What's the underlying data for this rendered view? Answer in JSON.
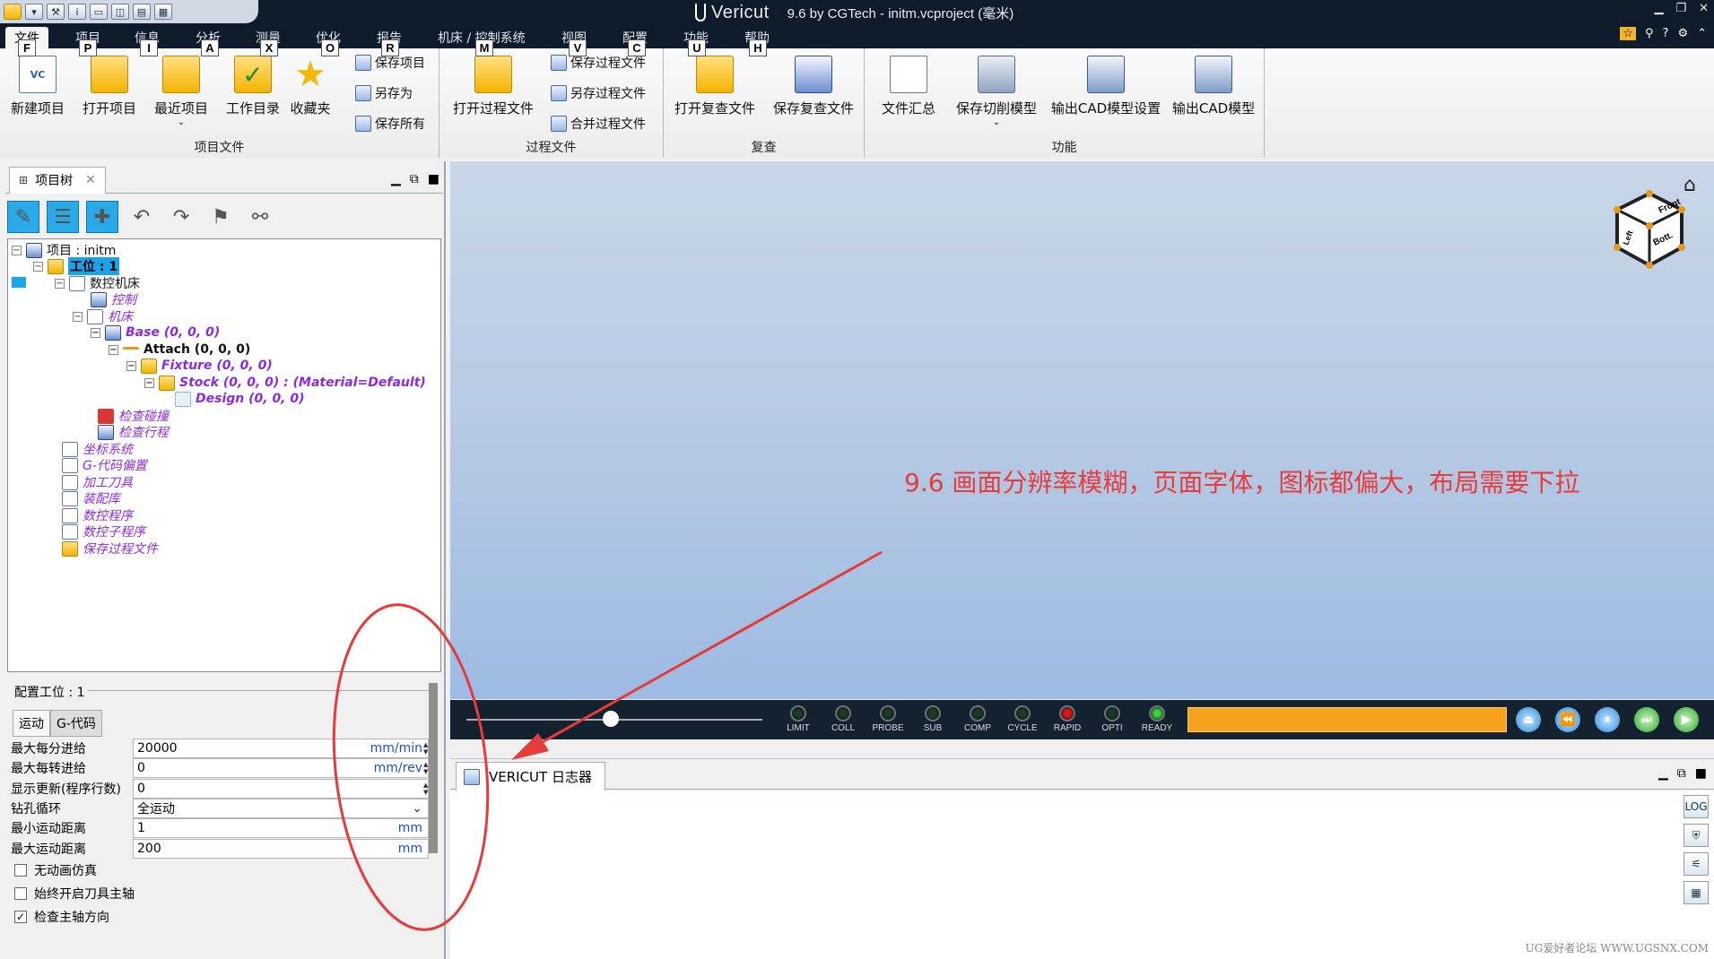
{
  "titlebar": {
    "brand": "Vericut",
    "title": "9.6 by CGTech - initm.vcproject (毫米)",
    "minimize": "▁",
    "restore": "❐",
    "close": "✕"
  },
  "tabs": {
    "file": "文件",
    "project": "项目",
    "info": "信息",
    "analysis": "分析",
    "measure": "测量",
    "optimize": "优化",
    "report": "报告",
    "machine": "机床 / 控制系统",
    "view": "视图",
    "config": "配置",
    "function": "功能",
    "help": "帮助"
  },
  "keytips": {
    "f": "F",
    "p": "P",
    "i": "I",
    "a": "A",
    "x": "X",
    "o": "O",
    "r": "R",
    "m": "M",
    "v": "V",
    "c": "C",
    "u": "U",
    "h": "H"
  },
  "ribbon": {
    "new_project": "新建项目",
    "open_project": "打开项目",
    "recent_project": "最近项目",
    "work_dir": "工作目录",
    "favorites": "收藏夹",
    "save_project": "保存项目",
    "save_as": "另存为",
    "save_all": "保存所有",
    "group_project": "项目文件",
    "open_process": "打开过程文件",
    "save_process": "保存过程文件",
    "save_process_as": "另存过程文件",
    "merge_process": "合并过程文件",
    "group_process": "过程文件",
    "open_review": "打开复查文件",
    "save_review": "保存复查文件",
    "group_review": "复查",
    "file_summary": "文件汇总",
    "save_cut_model": "保存切削模型",
    "export_cad_settings": "输出CAD模型设置",
    "export_cad": "输出CAD模型",
    "group_function": "功能"
  },
  "panel": {
    "tab_label": "项目树"
  },
  "tree": {
    "project": "项目 : initm",
    "setup": "工位 : 1",
    "cnc_machine": "数控机床",
    "control": "控制",
    "machine": "机床",
    "base": "Base (0, 0, 0)",
    "attach": "Attach (0, 0, 0)",
    "fixture": "Fixture (0, 0, 0)",
    "stock": "Stock (0, 0, 0) : (Material=Default)",
    "design": "Design (0, 0, 0)",
    "collision": "检查碰撞",
    "travel": "检查行程",
    "coord": "坐标系统",
    "gcode_offset": "G-代码偏置",
    "tools": "加工刀具",
    "assembly": "装配库",
    "nc_program": "数控程序",
    "nc_subprogram": "数控子程序",
    "save_process": "保存过程文件"
  },
  "config": {
    "title": "配置工位 : 1",
    "tab_motion": "运动",
    "tab_gcode": "G-代码",
    "fields": [
      {
        "label": "最大每分进给",
        "value": "20000",
        "unit": "mm/min"
      },
      {
        "label": "最大每转进给",
        "value": "0",
        "unit": "mm/rev"
      },
      {
        "label": "显示更新(程序行数)",
        "value": "0",
        "unit": ""
      },
      {
        "label": "钻孔循环",
        "value": "全运动",
        "unit": ""
      },
      {
        "label": "最小运动距离",
        "value": "1",
        "unit": "mm"
      },
      {
        "label": "最大运动距离",
        "value": "200",
        "unit": "mm"
      }
    ],
    "checks": [
      {
        "label": "无动画仿真",
        "checked": false
      },
      {
        "label": "始终开启刀具主轴",
        "checked": false
      },
      {
        "label": "检查主轴方向",
        "checked": true
      }
    ]
  },
  "viewport": {
    "annotation": "9.6 画面分辨率模糊，页面字体，图标都偏大，布局需要下拉",
    "cube_front": "Front",
    "cube_left": "Left",
    "cube_bottom": "Bott."
  },
  "status": {
    "leds": [
      {
        "label": "LIMIT",
        "color": "#1f3a26"
      },
      {
        "label": "COLL",
        "color": "#1f3a26"
      },
      {
        "label": "PROBE",
        "color": "#1f3a26"
      },
      {
        "label": "SUB",
        "color": "#1f3a26"
      },
      {
        "label": "COMP",
        "color": "#1f3a26"
      },
      {
        "label": "CYCLE",
        "color": "#1f3a26"
      },
      {
        "label": "RAPID",
        "color": "#d91a1a"
      },
      {
        "label": "OPTI",
        "color": "#1f3a26"
      },
      {
        "label": "READY",
        "color": "#3fd43a"
      }
    ],
    "progress_color": "#f7a21d"
  },
  "log": {
    "tab_label": "VERICUT 日志器"
  },
  "watermark": "UG爱好者论坛 WWW.UGSNX.COM"
}
